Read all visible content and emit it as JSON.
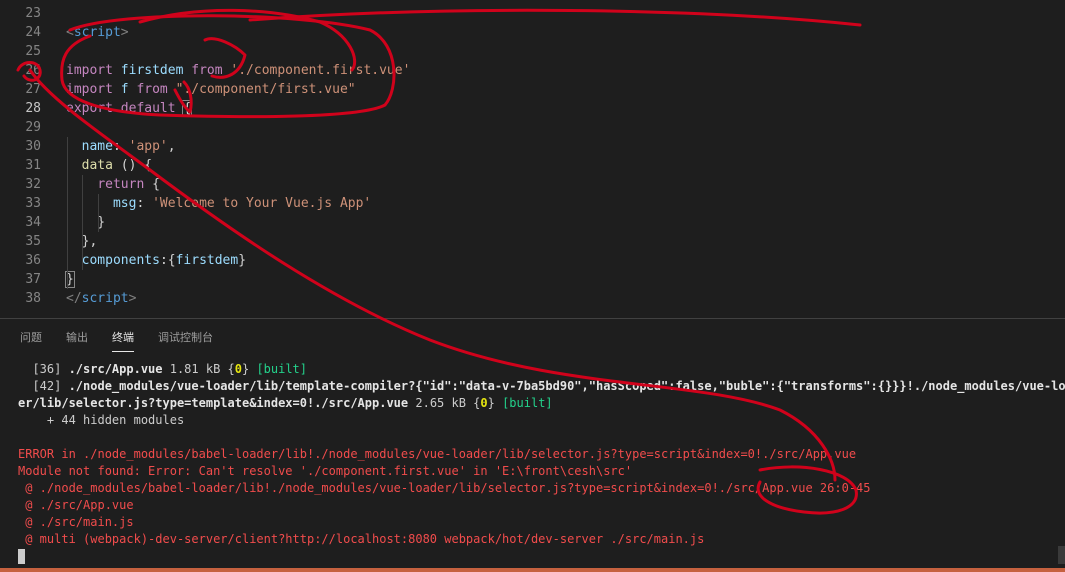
{
  "editor": {
    "lines": [
      {
        "n": "23",
        "parts": []
      },
      {
        "n": "24",
        "parts": [
          {
            "c": "tag",
            "t": "<"
          },
          {
            "c": "tname",
            "t": "script"
          },
          {
            "c": "tag",
            "t": ">"
          }
        ]
      },
      {
        "n": "25",
        "parts": []
      },
      {
        "n": "26",
        "parts": [
          {
            "c": "kw",
            "t": "import "
          },
          {
            "c": "id",
            "t": "firstdem "
          },
          {
            "c": "kw",
            "t": "from "
          },
          {
            "c": "str",
            "t": "'./component.first.vue'"
          }
        ]
      },
      {
        "n": "27",
        "parts": [
          {
            "c": "kw",
            "t": "import "
          },
          {
            "c": "id",
            "t": "f "
          },
          {
            "c": "kw",
            "t": "from "
          },
          {
            "c": "str",
            "t": "\"./component/first.vue\""
          }
        ]
      },
      {
        "n": "28",
        "active": true,
        "parts": [
          {
            "c": "kw",
            "t": "export default "
          },
          {
            "c": "pl box",
            "t": "{"
          }
        ]
      },
      {
        "n": "29",
        "parts": []
      },
      {
        "n": "30",
        "parts": [
          {
            "c": "pl",
            "t": "  "
          },
          {
            "c": "id",
            "t": "name"
          },
          {
            "c": "pl",
            "t": ": "
          },
          {
            "c": "str",
            "t": "'app'"
          },
          {
            "c": "pl",
            "t": ","
          }
        ]
      },
      {
        "n": "31",
        "parts": [
          {
            "c": "pl",
            "t": "  "
          },
          {
            "c": "fn",
            "t": "data"
          },
          {
            "c": "pl",
            "t": " () {"
          }
        ]
      },
      {
        "n": "32",
        "parts": [
          {
            "c": "pl",
            "t": "    "
          },
          {
            "c": "kw",
            "t": "return"
          },
          {
            "c": "pl",
            "t": " {"
          }
        ]
      },
      {
        "n": "33",
        "parts": [
          {
            "c": "pl",
            "t": "      "
          },
          {
            "c": "id",
            "t": "msg"
          },
          {
            "c": "pl",
            "t": ": "
          },
          {
            "c": "str",
            "t": "'Welcome to Your Vue.js App'"
          }
        ]
      },
      {
        "n": "34",
        "parts": [
          {
            "c": "pl",
            "t": "    }"
          }
        ]
      },
      {
        "n": "35",
        "parts": [
          {
            "c": "pl",
            "t": "  },"
          }
        ]
      },
      {
        "n": "36",
        "parts": [
          {
            "c": "pl",
            "t": "  "
          },
          {
            "c": "id",
            "t": "components"
          },
          {
            "c": "pl",
            "t": ":{"
          },
          {
            "c": "id",
            "t": "firstdem"
          },
          {
            "c": "pl",
            "t": "}"
          }
        ]
      },
      {
        "n": "37",
        "parts": [
          {
            "c": "pl box",
            "t": "}"
          }
        ]
      },
      {
        "n": "38",
        "parts": [
          {
            "c": "tag",
            "t": "</"
          },
          {
            "c": "tname",
            "t": "script"
          },
          {
            "c": "tag",
            "t": ">"
          }
        ]
      }
    ]
  },
  "panel": {
    "tabs": [
      {
        "label": "问题",
        "active": false
      },
      {
        "label": "输出",
        "active": false
      },
      {
        "label": "终端",
        "active": true
      },
      {
        "label": "调试控制台",
        "active": false
      }
    ]
  },
  "terminal": {
    "lines": [
      [
        {
          "c": "",
          "t": "  [36] "
        },
        {
          "c": "t-bold",
          "t": "./src/App.vue"
        },
        {
          "c": "",
          "t": " 1.81 kB {"
        },
        {
          "c": "t-yel",
          "t": "0"
        },
        {
          "c": "",
          "t": "} "
        },
        {
          "c": "t-grn",
          "t": "[built]"
        }
      ],
      [
        {
          "c": "",
          "t": "  [42] "
        },
        {
          "c": "t-bold",
          "t": "./node_modules/vue-loader/lib/template-compiler?{\"id\":\"data-v-7ba5bd90\",\"hasScoped\":false,\"buble\":{\"transforms\":{}}}!./node_modules/vue-load"
        }
      ],
      [
        {
          "c": "t-bold",
          "t": "er/lib/selector.js?type=template&index=0!./src/App.vue"
        },
        {
          "c": "",
          "t": " 2.65 kB {"
        },
        {
          "c": "t-yel",
          "t": "0"
        },
        {
          "c": "",
          "t": "} "
        },
        {
          "c": "t-grn",
          "t": "[built]"
        }
      ],
      [
        {
          "c": "",
          "t": "    + 44 hidden modules"
        }
      ],
      [
        {
          "c": "",
          "t": " "
        }
      ],
      [
        {
          "c": "t-red",
          "t": "ERROR in ./node_modules/babel-loader/lib!./node_modules/vue-loader/lib/selector.js?type=script&index=0!./src/App.vue"
        }
      ],
      [
        {
          "c": "t-red",
          "t": "Module not found: Error: Can't resolve './component.first.vue' in 'E:\\front\\cesh\\src'"
        }
      ],
      [
        {
          "c": "t-red",
          "t": " @ ./node_modules/babel-loader/lib!./node_modules/vue-loader/lib/selector.js?type=script&index=0!./src/App.vue 26:0-45"
        }
      ],
      [
        {
          "c": "t-red",
          "t": " @ ./src/App.vue"
        }
      ],
      [
        {
          "c": "t-red",
          "t": " @ ./src/main.js"
        }
      ],
      [
        {
          "c": "t-red",
          "t": " @ multi (webpack)-dev-server/client?http://localhost:8080 webpack/hot/dev-server ./src/main.js"
        }
      ]
    ]
  },
  "colors": {
    "annotation": "#d0021b",
    "status_bar": "#c6613f"
  }
}
